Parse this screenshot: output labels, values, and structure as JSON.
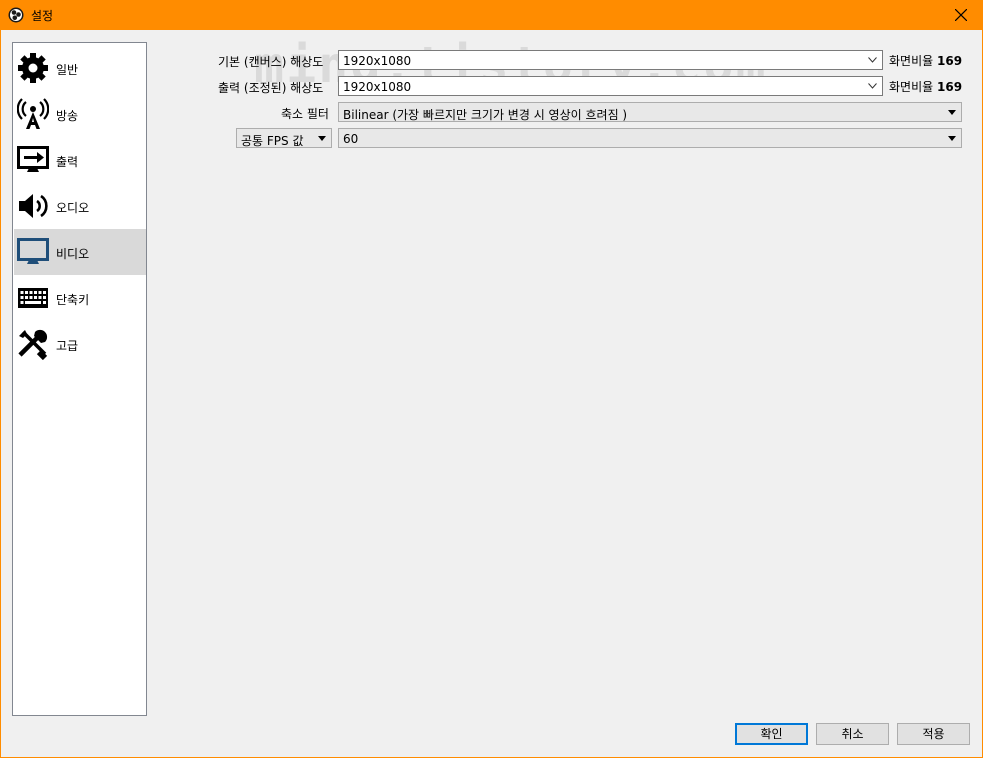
{
  "window": {
    "title": "설정"
  },
  "sidebar": {
    "items": [
      {
        "label": "일반",
        "icon": "gear-icon"
      },
      {
        "label": "방송",
        "icon": "broadcast-antenna-icon"
      },
      {
        "label": "출력",
        "icon": "output-monitor-icon"
      },
      {
        "label": "오디오",
        "icon": "speaker-icon"
      },
      {
        "label": "비디오",
        "icon": "monitor-icon",
        "selected": true
      },
      {
        "label": "단축키",
        "icon": "keyboard-icon"
      },
      {
        "label": "고급",
        "icon": "tools-icon"
      }
    ]
  },
  "video": {
    "base_resolution": {
      "label": "기본 (캔버스) 해상도",
      "value": "1920x1080",
      "ratio_label": "화면비율",
      "ratio_value": "169"
    },
    "output_resolution": {
      "label": "출력 (조정된) 해상도",
      "value": "1920x1080",
      "ratio_label": "화면비율",
      "ratio_value": "169"
    },
    "downscale_filter": {
      "label": "축소 필터",
      "value": "Bilinear (가장 빠르지만 크기가 변경 시 영상이 흐려짐 )"
    },
    "fps": {
      "type_label": "공통 FPS 값",
      "value": "60"
    }
  },
  "buttons": {
    "ok": "확인",
    "cancel": "취소",
    "apply": "적용"
  },
  "watermark": "ming.tistory.com",
  "colors": {
    "titlebar": "#ff8c00",
    "selected": "#d9d9d9",
    "focus": "#0078d7"
  }
}
